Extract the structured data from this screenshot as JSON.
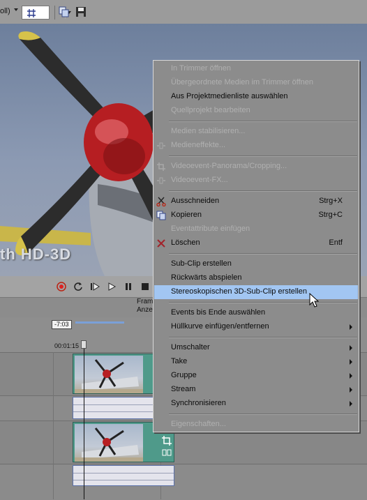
{
  "toolbar": {
    "label_fragment": "oll)",
    "grid_icon": "grid-icon",
    "copy_icon": "copy-icon",
    "save_icon": "save-icon"
  },
  "preview": {
    "watermark_text": "th HD-3D"
  },
  "transport": {
    "buttons": [
      "record-icon",
      "loop-icon",
      "play-from-start-icon",
      "play-icon",
      "pause-icon",
      "stop-icon"
    ],
    "frame_label_line1": "Fram",
    "frame_label_line2": "Anze"
  },
  "timeline": {
    "loop_badge": "-7:03",
    "cursor_time": "00:01:15"
  },
  "context_menu": {
    "items": [
      {
        "label": "In Trimmer öffnen",
        "enabled": false
      },
      {
        "label": "Übergeordnete Medien im Trimmer öffnen",
        "enabled": false
      },
      {
        "label": "Aus Projektmedienliste auswählen",
        "enabled": true
      },
      {
        "label": "Quellprojekt bearbeiten",
        "enabled": false
      },
      {
        "label": "Medien stabilisieren...",
        "enabled": false
      },
      {
        "label": "Medieneffekte...",
        "enabled": false,
        "icon": "media-fx-icon"
      },
      {
        "label": "Videoevent-Panorama/Cropping...",
        "enabled": false,
        "icon": "crop-icon"
      },
      {
        "label": "Videoevent-FX...",
        "enabled": false,
        "icon": "video-fx-icon"
      },
      {
        "label": "Ausschneiden",
        "shortcut": "Strg+X",
        "enabled": true,
        "icon": "scissors-icon"
      },
      {
        "label": "Kopieren",
        "shortcut": "Strg+C",
        "enabled": true,
        "icon": "copy-icon"
      },
      {
        "label": "Eventattribute einfügen",
        "enabled": false
      },
      {
        "label": "Löschen",
        "shortcut": "Entf",
        "enabled": true,
        "icon": "delete-x-icon"
      },
      {
        "label": "Sub-Clip erstellen",
        "enabled": true
      },
      {
        "label": "Rückwärts abspielen",
        "enabled": true
      },
      {
        "label": "Stereoskopischen 3D-Sub-Clip erstellen",
        "enabled": true,
        "highlighted": true
      },
      {
        "label": "Events bis Ende auswählen",
        "enabled": true
      },
      {
        "label": "Hüllkurve einfügen/entfernen",
        "enabled": true,
        "submenu": true
      },
      {
        "label": "Umschalter",
        "enabled": true,
        "submenu": true
      },
      {
        "label": "Take",
        "enabled": true,
        "submenu": true
      },
      {
        "label": "Gruppe",
        "enabled": true,
        "submenu": true
      },
      {
        "label": "Stream",
        "enabled": true,
        "submenu": true
      },
      {
        "label": "Synchronisieren",
        "enabled": true,
        "submenu": true
      },
      {
        "label": "Eigenschaften...",
        "enabled": false
      }
    ]
  },
  "colors": {
    "menu_highlight": "#a2c6f2",
    "disabled_text": "#b0b0b0",
    "video_clip": "#4f9a8a",
    "loop_bar": "#7aa0d8"
  }
}
